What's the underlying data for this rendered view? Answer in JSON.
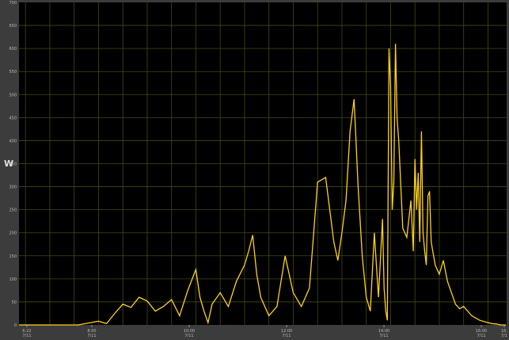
{
  "chart_data": {
    "type": "line",
    "ylabel": "W",
    "xlabel": "",
    "title": "",
    "ylim": [
      0,
      700
    ],
    "grid": true,
    "colors": {
      "background": "#000000",
      "frame": "#3c3c3c",
      "grid": "#3f4a12",
      "line": "#ffd21a"
    },
    "y_ticks": [
      "0",
      "50",
      "100",
      "150",
      "200",
      "250",
      "300",
      "350",
      "400",
      "450",
      "500",
      "550",
      "600",
      "650",
      "700"
    ],
    "x_ticks": [
      {
        "time": "6:22",
        "date": "7/11"
      },
      {
        "time": "8:00",
        "date": "7/11"
      },
      {
        "time": "10:00",
        "date": "7/11"
      },
      {
        "time": "12:00",
        "date": "7/11"
      },
      {
        "time": "14:00",
        "date": "7/11"
      },
      {
        "time": "16:00",
        "date": "7/11"
      },
      {
        "time": "16:",
        "date": "7/1"
      }
    ],
    "series": [
      {
        "x": [
          "06:22",
          "07:35",
          "07:50",
          "08:00",
          "08:10",
          "08:20",
          "08:30",
          "08:40",
          "08:50",
          "09:00",
          "09:10",
          "09:20",
          "09:30",
          "09:40",
          "09:50",
          "10:00",
          "10:05",
          "10:10",
          "10:15",
          "10:20",
          "10:30",
          "10:40",
          "10:50",
          "11:00",
          "11:05",
          "11:10",
          "11:15",
          "11:20",
          "11:30",
          "11:40",
          "11:50",
          "11:55",
          "12:00",
          "12:10",
          "12:20",
          "12:30",
          "12:40",
          "12:50",
          "12:55",
          "13:00",
          "13:05",
          "13:10",
          "13:15",
          "13:20",
          "13:25",
          "13:30",
          "13:35",
          "13:40",
          "13:45",
          "13:50",
          "13:52",
          "13:54",
          "13:56",
          "13:58",
          "14:00",
          "14:02",
          "14:04",
          "14:06",
          "14:08",
          "14:10",
          "14:15",
          "14:20",
          "14:25",
          "14:28",
          "14:30",
          "14:32",
          "14:34",
          "14:36",
          "14:38",
          "14:40",
          "14:42",
          "14:44",
          "14:46",
          "14:48",
          "14:50",
          "14:55",
          "15:00",
          "15:05",
          "15:10",
          "15:15",
          "15:20",
          "15:25",
          "15:30",
          "15:40",
          "15:50",
          "16:00",
          "16:05",
          "16:10",
          "16:15"
        ],
        "values": [
          0,
          0,
          5,
          8,
          3,
          25,
          45,
          38,
          60,
          52,
          30,
          40,
          55,
          20,
          75,
          120,
          60,
          30,
          5,
          45,
          70,
          40,
          95,
          130,
          160,
          195,
          110,
          60,
          20,
          40,
          150,
          110,
          70,
          40,
          80,
          310,
          320,
          180,
          140,
          200,
          270,
          420,
          490,
          300,
          150,
          60,
          30,
          200,
          60,
          230,
          80,
          30,
          10,
          600,
          520,
          250,
          310,
          610,
          450,
          400,
          210,
          190,
          270,
          160,
          360,
          250,
          330,
          180,
          420,
          200,
          160,
          130,
          280,
          290,
          180,
          130,
          110,
          140,
          95,
          70,
          45,
          35,
          40,
          20,
          10,
          5,
          3,
          2,
          0
        ]
      }
    ]
  }
}
